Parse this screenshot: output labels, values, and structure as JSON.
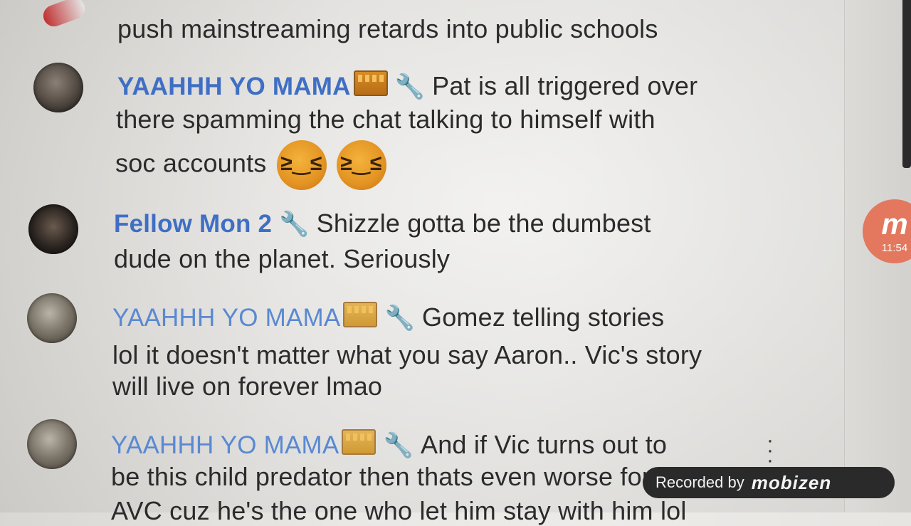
{
  "chat": {
    "messages": [
      {
        "id": "m0",
        "author": "",
        "text_lines": [
          "push mainstreaming retards into public schools"
        ],
        "partial_top": true
      },
      {
        "id": "m1",
        "author": "YAAHHH YO MAMA",
        "badges": [
          "crown-icon",
          "wrench-icon"
        ],
        "text_lines": [
          "Pat is all triggered over",
          "there spamming the chat talking to himself with",
          "soc accounts"
        ],
        "emojis": [
          "laughing-emoji",
          "laughing-emoji"
        ]
      },
      {
        "id": "m2",
        "author": "Fellow Mon 2",
        "badges": [
          "wrench-icon"
        ],
        "text_lines": [
          "Shizzle gotta be the dumbest",
          "dude on the planet. Seriously"
        ]
      },
      {
        "id": "m3",
        "author": "YAAHHH YO MAMA",
        "badges": [
          "crown-icon",
          "wrench-icon"
        ],
        "text_lines": [
          "Gomez telling stories",
          "lol it doesn't matter what you say Aaron.. Vic's story",
          "will live on forever lmao"
        ]
      },
      {
        "id": "m4",
        "author": "YAAHHH YO MAMA",
        "badges": [
          "crown-icon",
          "wrench-icon"
        ],
        "text_lines": [
          "And if Vic turns out to",
          "be this child predator then thats even worse for",
          "AVC cuz he's the one who let him stay with him lol"
        ]
      }
    ]
  },
  "overlay": {
    "recorded_label": "Recorded by",
    "recorded_brand": "mobizen",
    "bubble_letter": "m",
    "bubble_time": "11:54"
  },
  "colors": {
    "author_blue": "#3f6fc4",
    "crown_orange": "#d88a25",
    "bubble_orange": "#e3785e"
  }
}
